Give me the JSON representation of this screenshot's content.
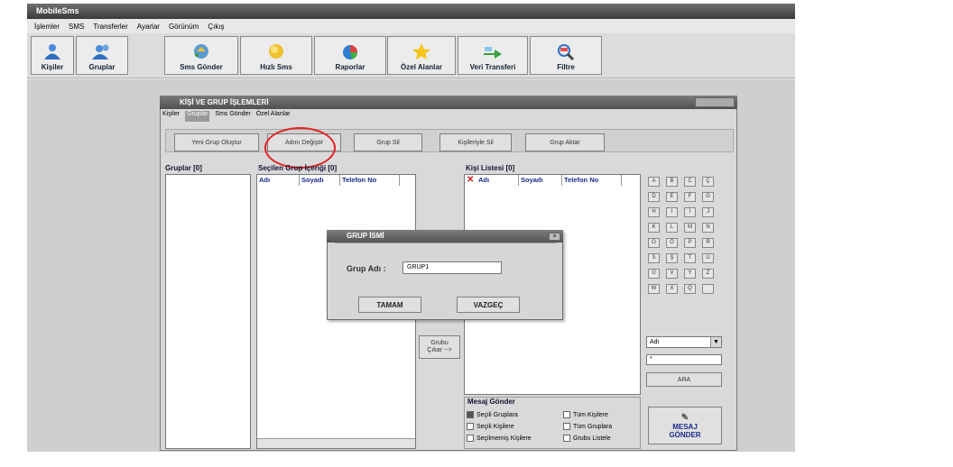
{
  "app": {
    "title": "MobileSms"
  },
  "menu": [
    "İşlemler",
    "SMS",
    "Transferler",
    "Ayarlar",
    "Görünüm",
    "Çıkış"
  ],
  "toolbar": [
    {
      "label": "Kişiler",
      "icon": "person-icon"
    },
    {
      "label": "Gruplar",
      "icon": "group-icon"
    },
    {
      "label": "Sms Gönder",
      "icon": "send-sms-icon"
    },
    {
      "label": "Hızlı Sms",
      "icon": "fast-sms-icon"
    },
    {
      "label": "Raporlar",
      "icon": "reports-icon"
    },
    {
      "label": "Özel Alanlar",
      "icon": "star-icon"
    },
    {
      "label": "Veri Transferi",
      "icon": "transfer-icon"
    },
    {
      "label": "Filtre",
      "icon": "filter-icon"
    }
  ],
  "window": {
    "title": "KİŞİ VE GRUP İŞLEMLERİ",
    "tabs": [
      "Kişiler",
      "Gruplar",
      "Sms Gönder",
      "Özel Alanlar"
    ],
    "active_tab": "Gruplar",
    "buttons": [
      "Yeni Grup Oluştur",
      "Adını Değiştir",
      "Grup Sil",
      "Kişileriyle Sil",
      "Grup Aktar"
    ],
    "groups_label": "Gruplar [0]",
    "selected_group_label": "Seçilen Grup İçeriği [0]",
    "contacts_label": "Kişi Listesi [0]",
    "columns": [
      "Adı",
      "Soyadı",
      "Telefon No"
    ],
    "remove_button": "Çıkar -->",
    "remove_button_top": "Grubu",
    "alphabet": [
      "A",
      "B",
      "C",
      "Ç",
      "D",
      "E",
      "F",
      "G",
      "H",
      "I",
      "İ",
      "J",
      "K",
      "L",
      "M",
      "N",
      "O",
      "Ö",
      "P",
      "R",
      "S",
      "Ş",
      "T",
      "U",
      "Ü",
      "V",
      "Y",
      "Z",
      "W",
      "X",
      "Q",
      ""
    ],
    "search_field": "Adı",
    "search_value": "*",
    "search_button": "ARA",
    "message_section": "Mesaj Gönder",
    "options_left": [
      {
        "label": "Seçili Gruplara",
        "checked": true
      },
      {
        "label": "Seçili Kişilere",
        "checked": false
      },
      {
        "label": "Seçilmemiş Kişilere",
        "checked": false
      }
    ],
    "options_right": [
      {
        "label": "Tüm Kişilere",
        "checked": false
      },
      {
        "label": "Tüm Gruplara",
        "checked": false
      },
      {
        "label": "Grubu Listele",
        "checked": false
      }
    ],
    "send_button": [
      "MESAJ",
      "GÖNDER"
    ]
  },
  "dialog": {
    "title": "GRUP İSMİ",
    "field_label": "Grup Adı :",
    "field_value": "GRUP1",
    "ok_button": "TAMAM",
    "cancel_button": "VAZGEÇ"
  },
  "colors": {
    "highlight_circle": "#e32222",
    "header_text": "#1a2a8a"
  }
}
